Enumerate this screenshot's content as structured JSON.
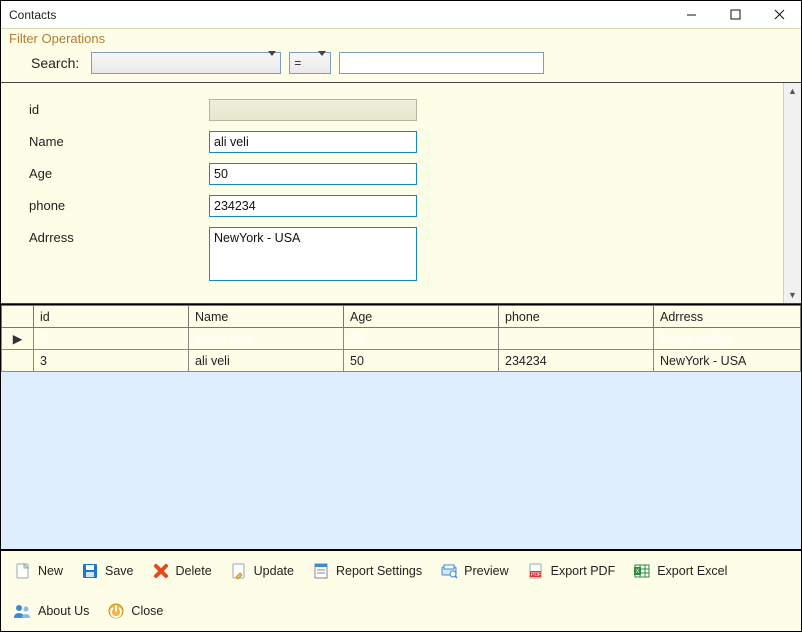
{
  "window": {
    "title": "Contacts"
  },
  "filter": {
    "legend": "Filter Operations",
    "search_label": "Search:",
    "field_value": "",
    "operator_value": "=",
    "term_value": ""
  },
  "form": {
    "fields": {
      "id": {
        "label": "id",
        "value": ""
      },
      "name": {
        "label": "Name",
        "value": "ali veli"
      },
      "age": {
        "label": "Age",
        "value": "50"
      },
      "phone": {
        "label": "phone",
        "value": "234234"
      },
      "address": {
        "label": "Adrress",
        "value": "NewYork - USA"
      }
    }
  },
  "grid": {
    "columns": [
      "id",
      "Name",
      "Age",
      "phone",
      "Adrress"
    ],
    "rows": [
      {
        "selected": true,
        "cells": [
          "2",
          "ismail özel",
          "29",
          "",
          "konya turkey"
        ]
      },
      {
        "selected": false,
        "cells": [
          "3",
          "ali veli",
          "50",
          "234234",
          "NewYork - USA"
        ]
      }
    ]
  },
  "toolbar": {
    "new": "New",
    "save": "Save",
    "delete": "Delete",
    "update": "Update",
    "report_settings": "Report Settings",
    "preview": "Preview",
    "export_pdf": "Export PDF",
    "export_excel": "Export Excel",
    "about": "About Us",
    "close": "Close"
  }
}
